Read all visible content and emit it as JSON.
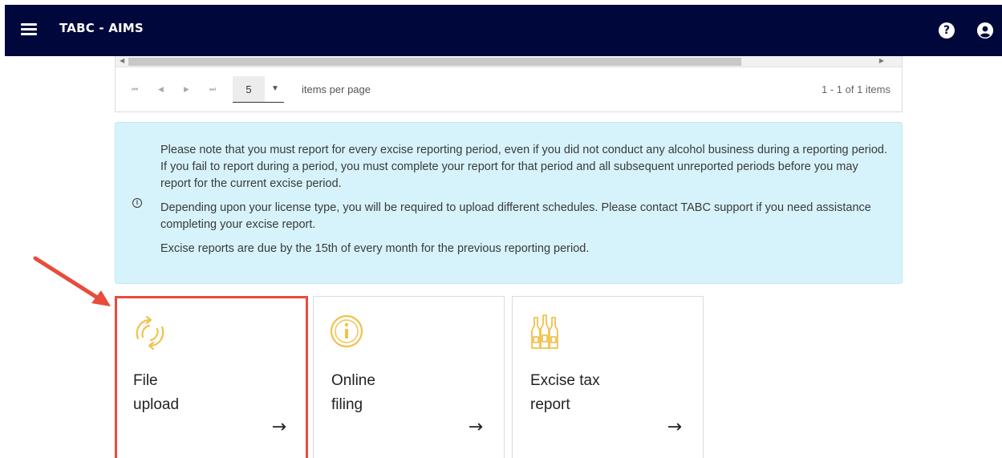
{
  "header": {
    "app_title": "TABC - AIMS",
    "menu_icon": "hamburger-menu-icon",
    "help_icon_glyph": "?",
    "user_icon": "account-circle-icon",
    "background": "#00083b"
  },
  "pager": {
    "first": "⏮",
    "prev": "◀",
    "next": "▶",
    "last": "⏭",
    "page_size": "5",
    "items_per_page_label": "items per page",
    "info": "1 - 1 of 1 items"
  },
  "notice": {
    "background": "#d6f3fb",
    "paragraphs": [
      "Please note that you must report for every excise reporting period, even if you did not conduct any alcohol business during a reporting period. If you fail to report during a period, you must complete your report for that period and all subsequent unreported periods before you may report for the current excise period.",
      "Depending upon your license type, you will be required to upload different schedules. Please contact TABC support if you need assistance completing your excise report.",
      "Excise reports are due by the 15th of every month for the previous reporting period."
    ]
  },
  "tiles": [
    {
      "title_line1": "File",
      "title_line2": "upload",
      "arrow": "→",
      "icon": "sync-arrows-icon",
      "highlighted": true
    },
    {
      "title_line1": "Online",
      "title_line2": "filing",
      "arrow": "→",
      "icon": "info-circle-icon",
      "highlighted": false
    },
    {
      "title_line1": "Excise tax",
      "title_line2": "report",
      "arrow": "→",
      "icon": "bottles-icon",
      "highlighted": false
    }
  ],
  "colors": {
    "accent_icon": "#f2c14e",
    "highlight": "#e74c3c"
  }
}
